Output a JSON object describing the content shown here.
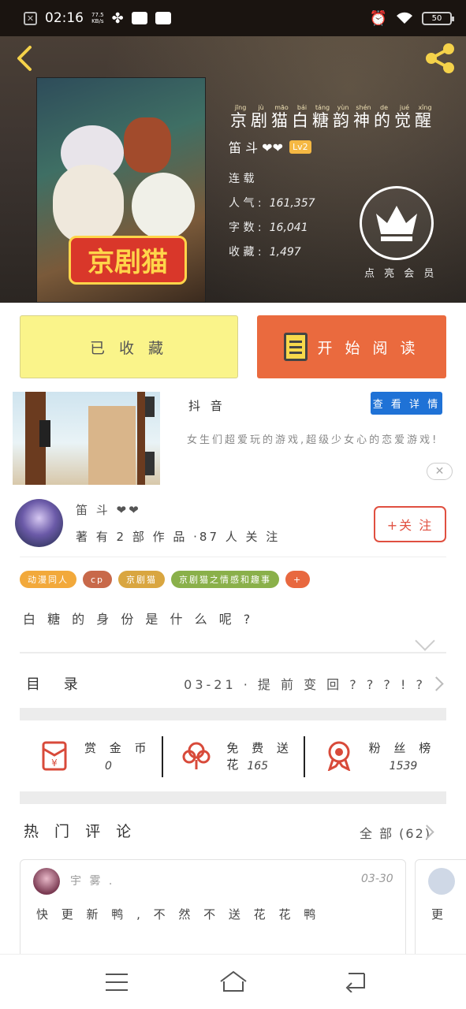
{
  "status_bar": {
    "time": "02:16",
    "net_speed_value": "77.5",
    "net_speed_unit": "KB/s",
    "battery": "50"
  },
  "header": {
    "title": [
      "京",
      "剧",
      "猫",
      "白",
      "糖",
      "韵",
      "神",
      "的",
      "觉",
      "醒"
    ],
    "title_pinyin": [
      "jīng",
      "jù",
      "māo",
      "bái",
      "táng",
      "yùn",
      "shén",
      "de",
      "jué",
      "xǐng"
    ],
    "author": "笛 斗 ❤❤",
    "level": "Lv2",
    "status": "连 载",
    "popularity_label": "人 气 :",
    "popularity": "161,357",
    "wordcount_label": "字 数 :",
    "wordcount": "16,041",
    "favorites_label": "收 藏 :",
    "favorites": "1,497",
    "reward_label": "点 亮 会 员",
    "cover_logo": "京剧猫"
  },
  "actions": {
    "collect": "已 收 藏",
    "read": "开 始 阅 读"
  },
  "ad": {
    "brand": "抖 音",
    "button": "查 看 详 情",
    "description": "女生们超爱玩的游戏,超级少女心的恋爱游戏!",
    "close": "✕"
  },
  "author_panel": {
    "name": "笛 斗 ❤❤",
    "stats": "著 有 2 部 作 品 ·87 人 关 注",
    "follow": "+关 注"
  },
  "tags": [
    {
      "label": "动漫同人",
      "color": "#f2a93b"
    },
    {
      "label": "cp",
      "color": "#c8694a"
    },
    {
      "label": "京剧猫",
      "color": "#d9a640"
    },
    {
      "label": "京剧猫之情感和趣事",
      "color": "#8ab04a"
    },
    {
      "label": "+",
      "color": "#e8683f"
    }
  ],
  "description": "白 糖 的 身 份 是 什 么 呢 ?",
  "toc": {
    "label": "目 录",
    "latest": "03-21 · 提 前 变 回 ? ? ? ! ?"
  },
  "rewards": [
    {
      "label": "赏 金 币",
      "value": "0",
      "icon": "gold-coin-envelope-icon"
    },
    {
      "label": "免 费 送 花",
      "value": "165",
      "icon": "flower-icon"
    },
    {
      "label": "粉 丝 榜",
      "value": "1539",
      "icon": "medal-icon"
    }
  ],
  "hot_comments": {
    "title": "热 门 评 论",
    "all": "全 部 (62)",
    "items": [
      {
        "user": "宇 雾 .",
        "date": "03-30",
        "text": "快 更 新 鸭 , 不 然 不 送 花 花 鸭"
      },
      {
        "user": "",
        "date": "",
        "text": "更"
      }
    ]
  },
  "colors": {
    "accent_orange": "#ea6a3e",
    "collect_yellow": "#faf48a",
    "ad_blue": "#1f72d6",
    "follow_red": "#e05040",
    "icon_gold": "#f5d24a"
  }
}
